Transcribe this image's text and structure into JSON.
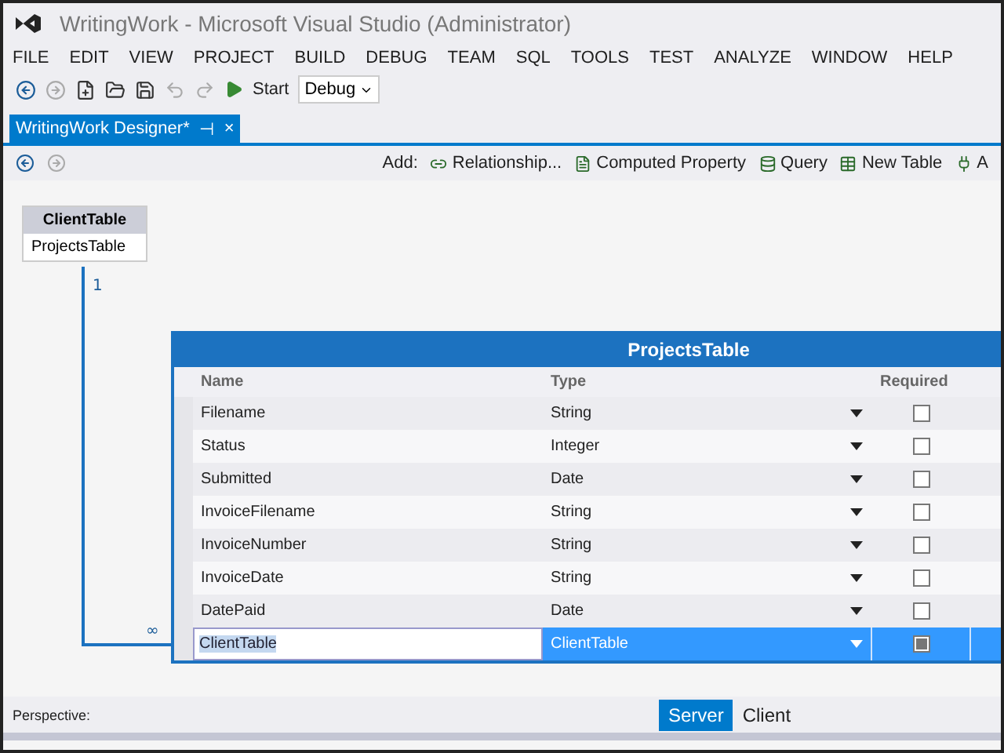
{
  "window": {
    "title": "WritingWork - Microsoft Visual Studio (Administrator)"
  },
  "menu": [
    "FILE",
    "EDIT",
    "VIEW",
    "PROJECT",
    "BUILD",
    "DEBUG",
    "TEAM",
    "SQL",
    "TOOLS",
    "TEST",
    "ANALYZE",
    "WINDOW",
    "HELP"
  ],
  "toolbar": {
    "start_label": "Start",
    "configuration": "Debug"
  },
  "document_tab": {
    "label": "WritingWork Designer*",
    "pin": "⊣",
    "close": "×"
  },
  "designer_toolbar": {
    "add_label": "Add:",
    "actions": [
      {
        "label": "Relationship..."
      },
      {
        "label": "Computed Property"
      },
      {
        "label": "Query"
      },
      {
        "label": "New Table"
      },
      {
        "label": "A"
      }
    ]
  },
  "client_table": {
    "title": "ClientTable",
    "fields": [
      "ProjectsTable"
    ]
  },
  "relationship": {
    "one_label": "1",
    "many_label": "∞"
  },
  "projects_table": {
    "title": "ProjectsTable",
    "columns": [
      "Name",
      "Type",
      "Required"
    ],
    "rows": [
      {
        "name": "Filename",
        "type": "String",
        "required": false,
        "selected": false
      },
      {
        "name": "Status",
        "type": "Integer",
        "required": false,
        "selected": false
      },
      {
        "name": "Submitted",
        "type": "Date",
        "required": false,
        "selected": false
      },
      {
        "name": "InvoiceFilename",
        "type": "String",
        "required": false,
        "selected": false
      },
      {
        "name": "InvoiceNumber",
        "type": "String",
        "required": false,
        "selected": false
      },
      {
        "name": "InvoiceDate",
        "type": "String",
        "required": false,
        "selected": false
      },
      {
        "name": "DatePaid",
        "type": "Date",
        "required": false,
        "selected": false
      },
      {
        "name": "ClientTable",
        "type": "ClientTable",
        "required": true,
        "selected": true
      }
    ]
  },
  "perspective": {
    "label": "Perspective:",
    "options": [
      {
        "label": "Server",
        "selected": true
      },
      {
        "label": "Client",
        "selected": false
      }
    ]
  }
}
